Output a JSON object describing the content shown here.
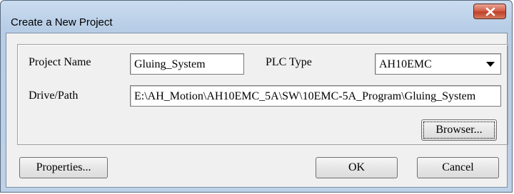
{
  "window": {
    "title": "Create a New Project"
  },
  "form": {
    "project_name_label": "Project Name",
    "project_name_value": "Gluing_System",
    "plc_type_label": "PLC Type",
    "plc_type_value": "AH10EMC",
    "drive_path_label": "Drive/Path",
    "drive_path_value": "E:\\AH_Motion\\AH10EMC_5A\\SW\\10EMC-5A_Program\\Gluing_System"
  },
  "buttons": {
    "browser": "Browser...",
    "properties": "Properties...",
    "ok": "OK",
    "cancel": "Cancel"
  }
}
